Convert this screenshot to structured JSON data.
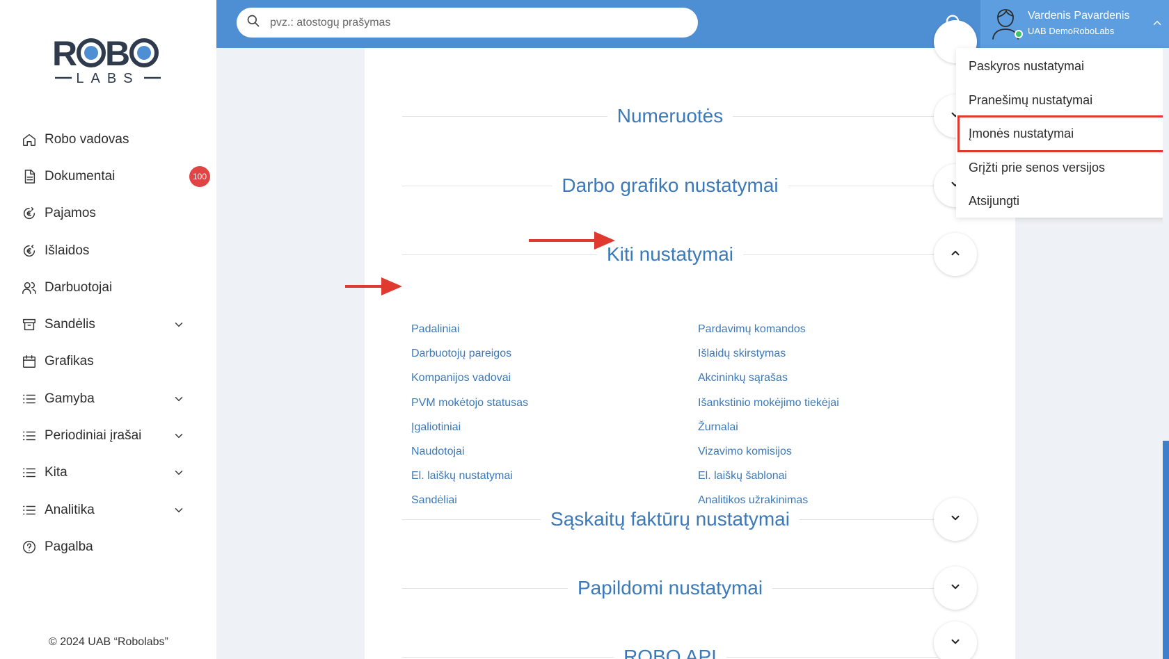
{
  "sidebar": {
    "logo": {
      "top": "ROBO",
      "bottom": "LABS"
    },
    "items": [
      {
        "label": "Robo vadovas",
        "icon": "home-icon",
        "has_chevron": false
      },
      {
        "label": "Dokumentai",
        "icon": "document-icon",
        "badge": "100",
        "has_chevron": false
      },
      {
        "label": "Pajamos",
        "icon": "euro-income-icon",
        "has_chevron": false
      },
      {
        "label": "Išlaidos",
        "icon": "euro-expense-icon",
        "has_chevron": false
      },
      {
        "label": "Darbuotojai",
        "icon": "users-icon",
        "has_chevron": false
      },
      {
        "label": "Sandėlis",
        "icon": "archive-icon",
        "has_chevron": true
      },
      {
        "label": "Grafikas",
        "icon": "calendar-icon",
        "has_chevron": false
      },
      {
        "label": "Gamyba",
        "icon": "list-icon",
        "has_chevron": true
      },
      {
        "label": "Periodiniai įrašai",
        "icon": "list-icon",
        "has_chevron": true
      },
      {
        "label": "Kita",
        "icon": "list-icon",
        "has_chevron": true
      },
      {
        "label": "Analitika",
        "icon": "list-icon",
        "has_chevron": true
      },
      {
        "label": "Pagalba",
        "icon": "help-icon",
        "has_chevron": false
      }
    ],
    "copyright": "© 2024 UAB “Robolabs”"
  },
  "topbar": {
    "search_placeholder": "pvz.: atostogų prašymas",
    "user_name": "Vardenis Pavardenis",
    "user_company": "UAB DemoRoboLabs"
  },
  "user_menu": {
    "items": [
      "Paskyros nustatymai",
      "Pranešimų nustatymai",
      "Įmonės nustatymai",
      "Grįžti prie senos versijos",
      "Atsijungti"
    ],
    "highlighted_index": 2
  },
  "settings": {
    "sections": [
      {
        "title": "Numeruotės",
        "expanded": false
      },
      {
        "title": "Darbo grafiko nustatymai",
        "expanded": false
      },
      {
        "title": "Kiti nustatymai",
        "expanded": true
      },
      {
        "title": "Sąskaitų faktūrų nustatymai",
        "expanded": false
      },
      {
        "title": "Papildomi nustatymai",
        "expanded": false
      },
      {
        "title": "ROBO API",
        "expanded": false
      }
    ],
    "kiti_links_left": [
      "Padaliniai",
      "Darbuotojų pareigos",
      "Kompanijos vadovai",
      "PVM mokėtojo statusas",
      "Įgaliotiniai",
      "Naudotojai",
      "El. laiškų nustatymai",
      "Sandėliai"
    ],
    "kiti_links_right": [
      "Pardavimų komandos",
      "Išlaidų skirstymas",
      "Akcininkų sąrašas",
      "Išankstinio mokėjimo tiekėjai",
      "Žurnalai",
      "Vizavimo komisijos",
      "El. laiškų šablonai",
      "Analitikos užrakinimas"
    ]
  },
  "colors": {
    "topbar": "#4e8fd4",
    "user_area": "#5d9ee0",
    "link": "#3b79b9",
    "badge": "#e04444",
    "annotation": "#e0392f"
  }
}
